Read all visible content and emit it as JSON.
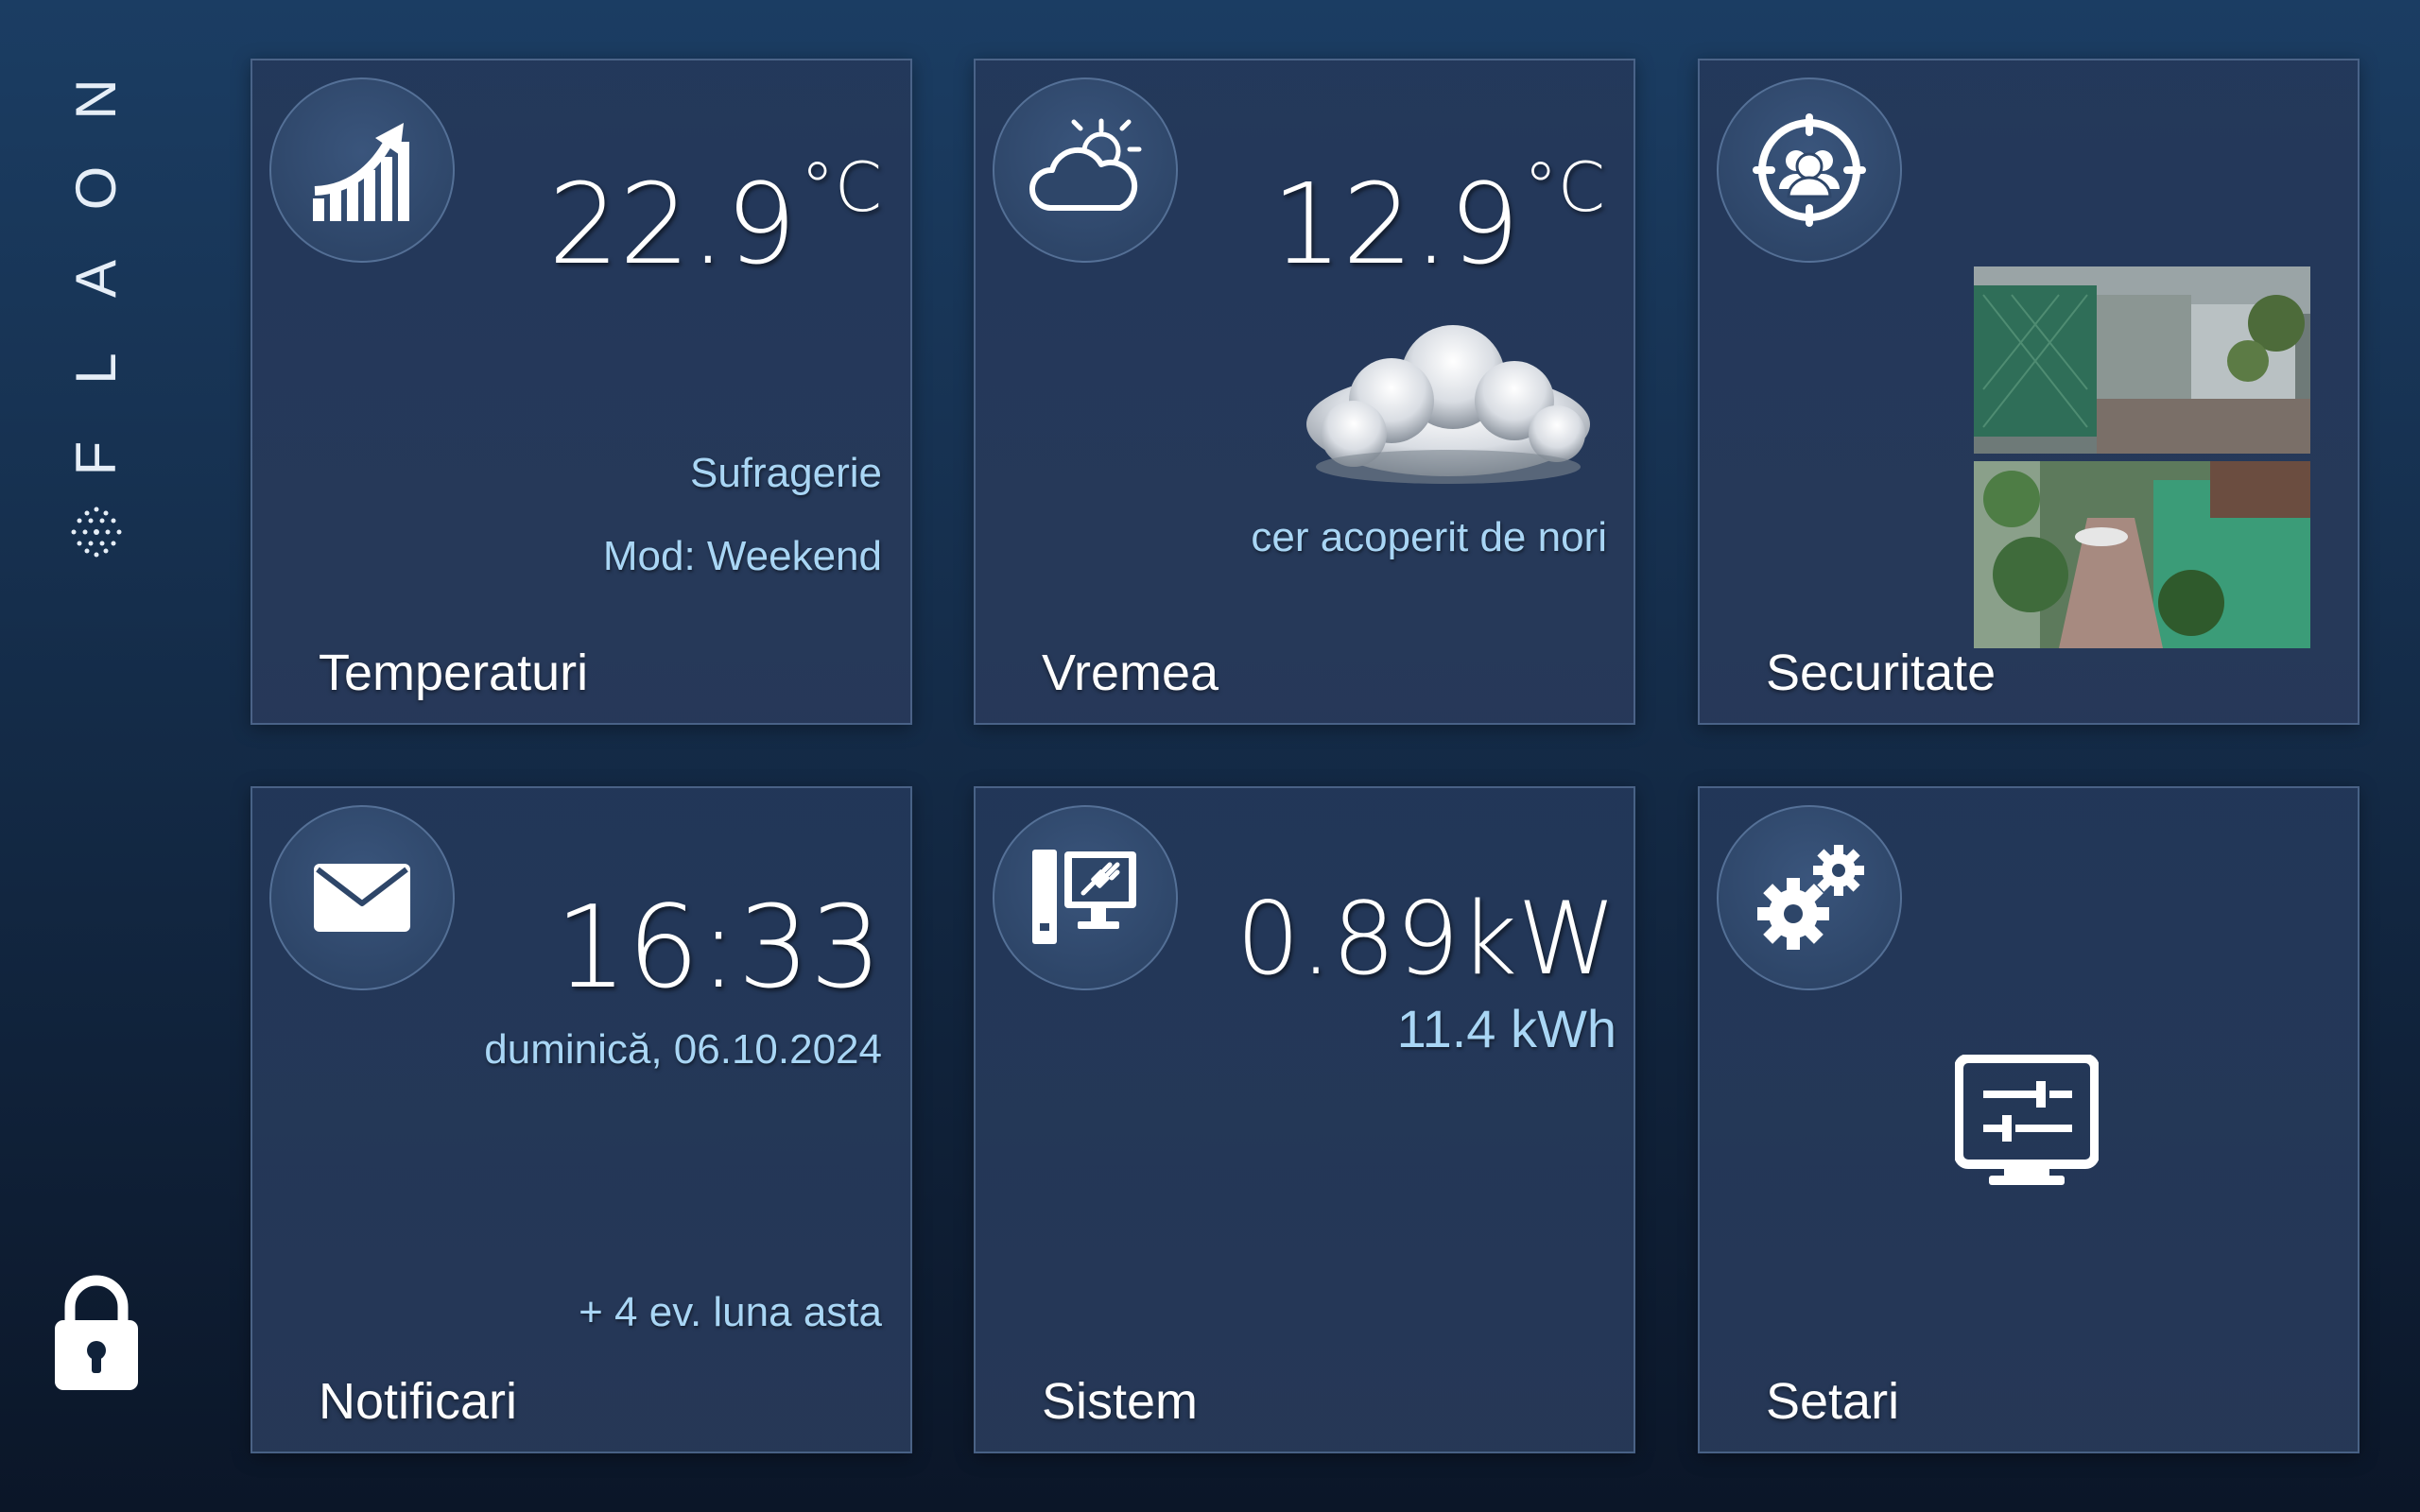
{
  "brand": {
    "letters": [
      "N",
      "O",
      "A",
      "L",
      "F"
    ]
  },
  "colors": {
    "accent": "#a9d6f5",
    "tile_bg": "#26395a",
    "text": "#ffffff"
  },
  "tiles": {
    "temperaturi": {
      "title": "Temperaturi",
      "value": "22.9",
      "unit": "°C",
      "room": "Sufragerie",
      "mode": "Mod: Weekend",
      "icon": "chart-up-icon"
    },
    "vremea": {
      "title": "Vremea",
      "value": "12.9",
      "unit": "°C",
      "condition": "cer acoperit de nori",
      "icon": "partly-cloudy-icon"
    },
    "securitate": {
      "title": "Securitate",
      "icon": "security-users-icon"
    },
    "notificari": {
      "title": "Notificari",
      "time": "16:33",
      "date": "duminică, 06.10.2024",
      "events": "+ 4 ev. luna asta",
      "icon": "envelope-icon"
    },
    "sistem": {
      "title": "Sistem",
      "power": "0.89kW",
      "energy": "11.4 kWh",
      "icon": "computer-plug-icon"
    },
    "setari": {
      "title": "Setari",
      "icon": "gears-icon"
    }
  }
}
